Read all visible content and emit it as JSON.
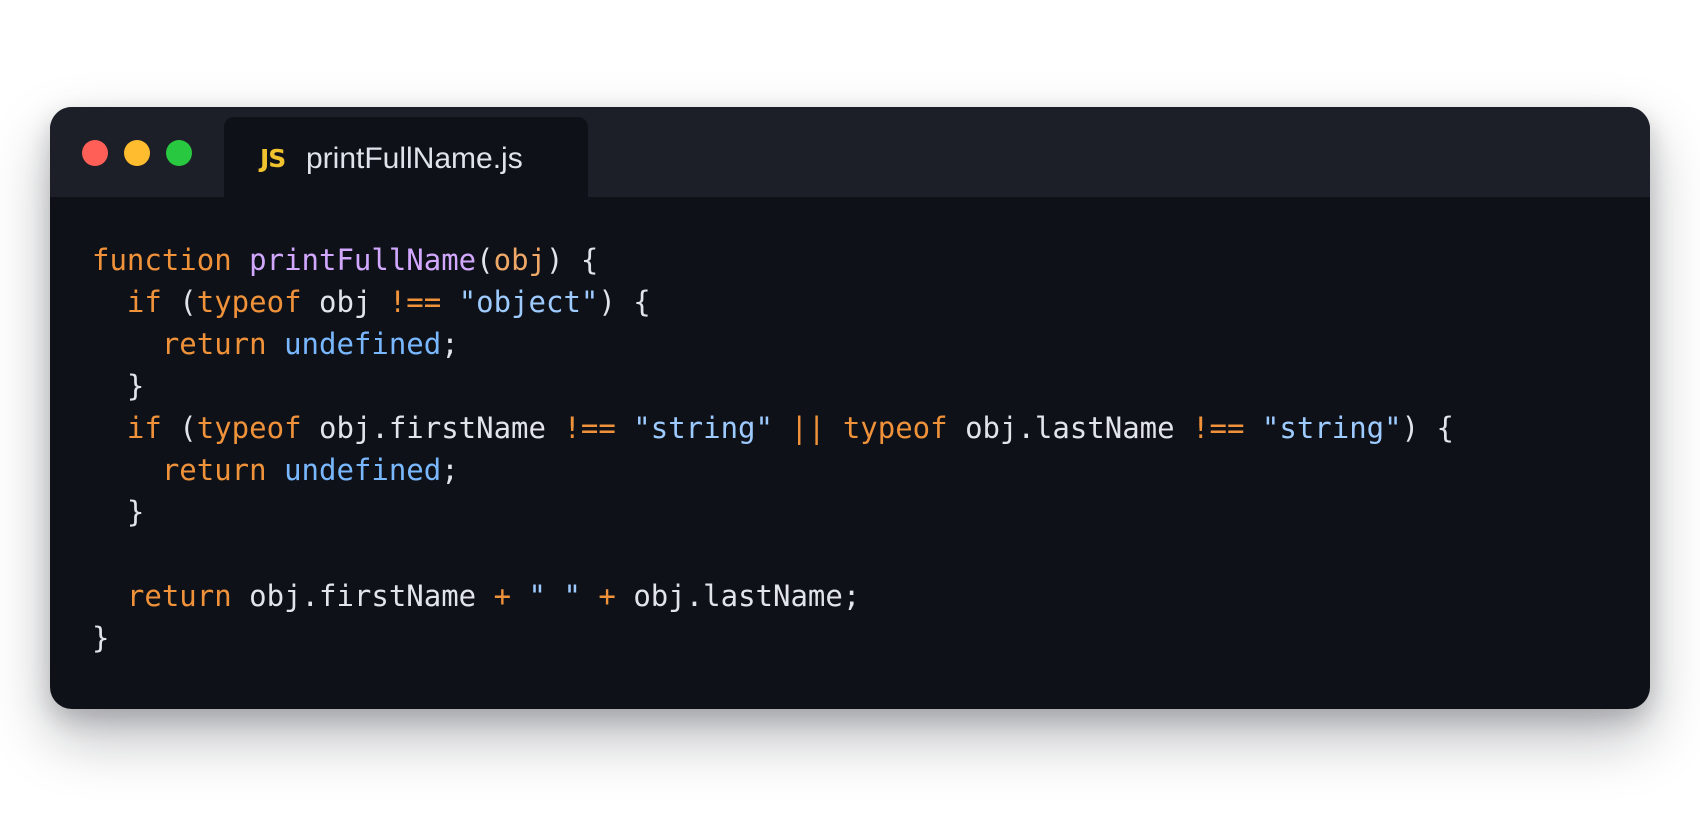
{
  "colors": {
    "page_background": "#ffffff",
    "editor_background": "#0e1118",
    "titlebar_background": "#1c1f27",
    "window_close": "#ff5f57",
    "window_minimize": "#febc2e",
    "window_maximize": "#28c840",
    "js_badge": "#f0c22e",
    "keyword": "#f0923a",
    "function_name": "#d2a8ff",
    "parameter": "#f0a868",
    "string": "#9ecbff",
    "builtin_value": "#79b8ff",
    "default_text": "#e1e4e8"
  },
  "window": {
    "controls": [
      {
        "name": "close-button",
        "icon": "red-circle-icon"
      },
      {
        "name": "minimize-button",
        "icon": "yellow-circle-icon"
      },
      {
        "name": "maximize-button",
        "icon": "green-circle-icon"
      }
    ]
  },
  "tab": {
    "icon_text": "JS",
    "icon_name": "javascript-file-icon",
    "filename": "printFullName.js"
  },
  "code": {
    "language": "javascript",
    "lines": [
      [
        {
          "text": "function",
          "type": "keyword"
        },
        {
          "text": " ",
          "type": "plain"
        },
        {
          "text": "printFullName",
          "type": "function_name"
        },
        {
          "text": "(",
          "type": "plain"
        },
        {
          "text": "obj",
          "type": "parameter"
        },
        {
          "text": ") {",
          "type": "plain"
        }
      ],
      [
        {
          "text": "  ",
          "type": "plain"
        },
        {
          "text": "if",
          "type": "keyword"
        },
        {
          "text": " (",
          "type": "plain"
        },
        {
          "text": "typeof",
          "type": "keyword"
        },
        {
          "text": " obj ",
          "type": "plain"
        },
        {
          "text": "!==",
          "type": "keyword"
        },
        {
          "text": " ",
          "type": "plain"
        },
        {
          "text": "\"object\"",
          "type": "string"
        },
        {
          "text": ") {",
          "type": "plain"
        }
      ],
      [
        {
          "text": "    ",
          "type": "plain"
        },
        {
          "text": "return",
          "type": "keyword"
        },
        {
          "text": " ",
          "type": "plain"
        },
        {
          "text": "undefined",
          "type": "builtin_value"
        },
        {
          "text": ";",
          "type": "plain"
        }
      ],
      [
        {
          "text": "  }",
          "type": "plain"
        }
      ],
      [
        {
          "text": "  ",
          "type": "plain"
        },
        {
          "text": "if",
          "type": "keyword"
        },
        {
          "text": " (",
          "type": "plain"
        },
        {
          "text": "typeof",
          "type": "keyword"
        },
        {
          "text": " obj.firstName ",
          "type": "plain"
        },
        {
          "text": "!==",
          "type": "keyword"
        },
        {
          "text": " ",
          "type": "plain"
        },
        {
          "text": "\"string\"",
          "type": "string"
        },
        {
          "text": " ",
          "type": "plain"
        },
        {
          "text": "||",
          "type": "keyword"
        },
        {
          "text": " ",
          "type": "plain"
        },
        {
          "text": "typeof",
          "type": "keyword"
        },
        {
          "text": " obj.lastName ",
          "type": "plain"
        },
        {
          "text": "!==",
          "type": "keyword"
        },
        {
          "text": " ",
          "type": "plain"
        },
        {
          "text": "\"string\"",
          "type": "string"
        },
        {
          "text": ") {",
          "type": "plain"
        }
      ],
      [
        {
          "text": "    ",
          "type": "plain"
        },
        {
          "text": "return",
          "type": "keyword"
        },
        {
          "text": " ",
          "type": "plain"
        },
        {
          "text": "undefined",
          "type": "builtin_value"
        },
        {
          "text": ";",
          "type": "plain"
        }
      ],
      [
        {
          "text": "  }",
          "type": "plain"
        }
      ],
      [],
      [
        {
          "text": "  ",
          "type": "plain"
        },
        {
          "text": "return",
          "type": "keyword"
        },
        {
          "text": " obj.firstName ",
          "type": "plain"
        },
        {
          "text": "+",
          "type": "keyword"
        },
        {
          "text": " ",
          "type": "plain"
        },
        {
          "text": "\" \"",
          "type": "string"
        },
        {
          "text": " ",
          "type": "plain"
        },
        {
          "text": "+",
          "type": "keyword"
        },
        {
          "text": " obj.lastName;",
          "type": "plain"
        }
      ],
      [
        {
          "text": "}",
          "type": "plain"
        }
      ]
    ]
  }
}
